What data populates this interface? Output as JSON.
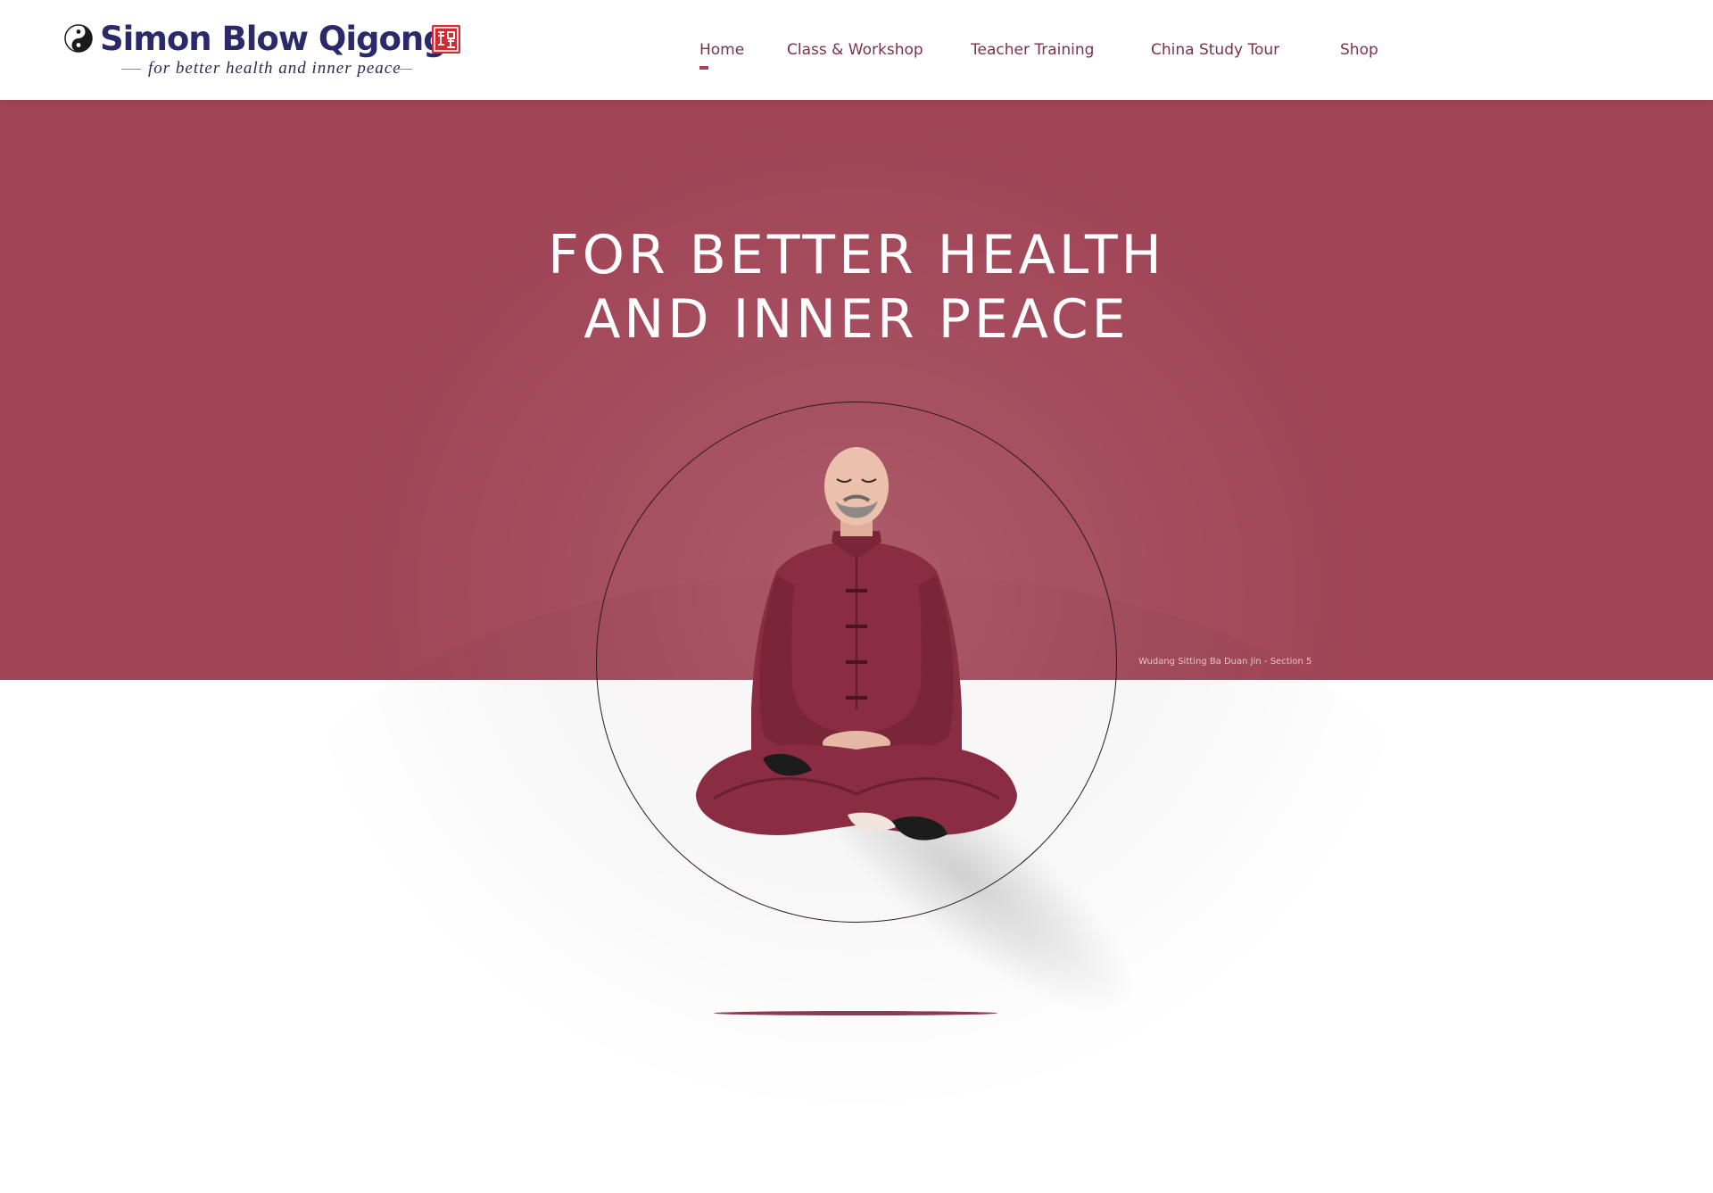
{
  "brand": {
    "name": "Simon Blow Qigong",
    "tagline": "for better health and inner peace",
    "logo_icon": "yin-yang-icon",
    "seal_icon": "chinese-seal-icon",
    "name_color": "#2a2a6a",
    "seal_color": "#d02a32"
  },
  "nav": {
    "items": [
      {
        "label": "Home",
        "active": true
      },
      {
        "label": "Class & Workshop",
        "active": false
      },
      {
        "label": "Teacher Training",
        "active": false
      },
      {
        "label": "China Study Tour",
        "active": false
      },
      {
        "label": "Shop",
        "active": false
      }
    ],
    "color": "#7a3346"
  },
  "hero": {
    "headline_line1": "FOR BETTER HEALTH",
    "headline_line2": "AND INNER PEACE",
    "caption": "Wudang Sitting Ba Duan Jin - Section 5",
    "background_color": "#a04456",
    "figure": "meditating-man-figure"
  }
}
